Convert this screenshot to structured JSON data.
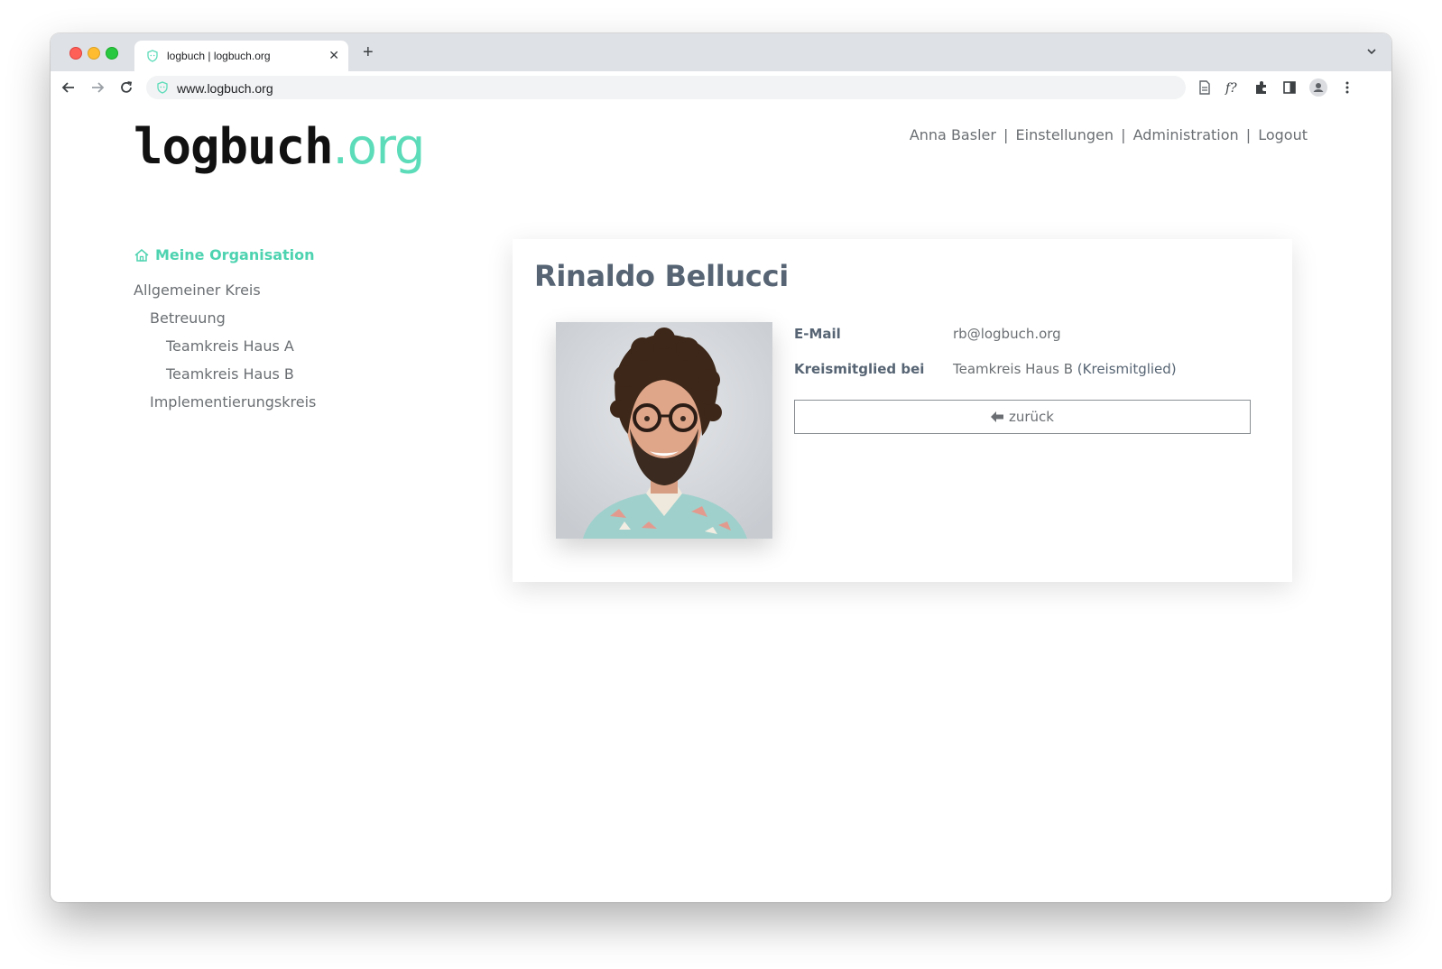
{
  "browser": {
    "tab_title": "logbuch | logbuch.org",
    "url": "www.logbuch.org"
  },
  "logo": {
    "main": "logbuch",
    "suffix": ".org"
  },
  "topnav": {
    "user": "Anna Basler",
    "settings": "Einstellungen",
    "admin": "Administration",
    "logout": "Logout",
    "separator": "|"
  },
  "sidebar": {
    "heading": "Meine Organisation",
    "items": [
      {
        "label": "Allgemeiner Kreis"
      },
      {
        "label": "Betreuung"
      },
      {
        "label": "Teamkreis Haus A"
      },
      {
        "label": "Teamkreis Haus B"
      },
      {
        "label": "Implementierungskreis"
      }
    ]
  },
  "profile": {
    "name": "Rinaldo Bellucci",
    "email_label": "E-Mail",
    "email_value": "rb@logbuch.org",
    "member_label": "Kreismitglied bei",
    "member_circle": "Teamkreis Haus B",
    "member_role": "(Kreismitglied)",
    "back_label": "zurück"
  },
  "colors": {
    "accent": "#5ddcb9",
    "heading": "#566473",
    "text": "#6b6f73"
  }
}
